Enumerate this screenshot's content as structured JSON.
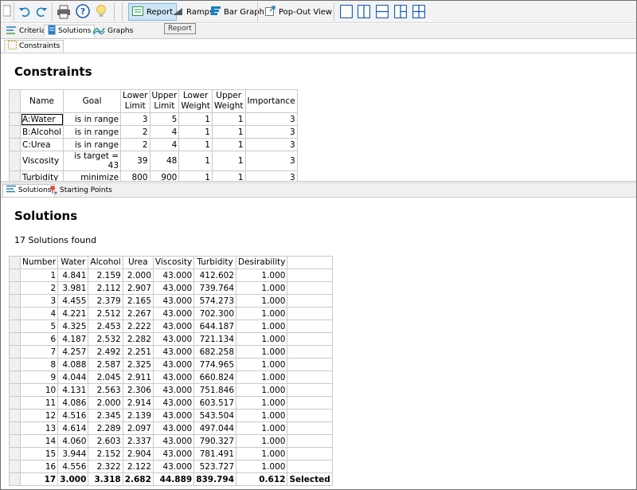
{
  "toolbar": {
    "report_label": "Report",
    "ramps_label": "Ramps",
    "bargraph_label": "Bar Graph",
    "popout_label": "Pop-Out View",
    "tooltip": "Report",
    "colors": {
      "accent": "#1a7fc1",
      "bulb": "#f7c948",
      "print": "#555555"
    }
  },
  "top_tabs": [
    {
      "label": "Criteria",
      "icon": "criteria-icon"
    },
    {
      "label": "Solutions",
      "icon": "solutions-icon"
    },
    {
      "label": "Graphs",
      "icon": "graphs-icon"
    }
  ],
  "sub_tab_constraints": {
    "label": "Constraints"
  },
  "constraints": {
    "title": "Constraints",
    "headers": [
      "Name",
      "Goal",
      "Lower\nLimit",
      "Upper\nLimit",
      "Lower\nWeight",
      "Upper\nWeight",
      "Importance"
    ],
    "rows": [
      [
        "A:Water",
        "is in range",
        "3",
        "5",
        "1",
        "1",
        "3"
      ],
      [
        "B:Alcohol",
        "is in range",
        "2",
        "4",
        "1",
        "1",
        "3"
      ],
      [
        "C:Urea",
        "is in range",
        "2",
        "4",
        "1",
        "1",
        "3"
      ],
      [
        "Viscosity",
        "is target = 43",
        "39",
        "48",
        "1",
        "1",
        "3"
      ],
      [
        "Turbidity",
        "minimize",
        "800",
        "900",
        "1",
        "1",
        "3"
      ]
    ]
  },
  "lower_tabs": [
    {
      "label": "Solutions",
      "icon": "solutions-icon"
    },
    {
      "label": "Starting Points",
      "icon": "pin-icon"
    }
  ],
  "solutions": {
    "title": "Solutions",
    "found_text": "17 Solutions found",
    "headers": [
      "Number",
      "Water",
      "Alcohol",
      "Urea",
      "Viscosity",
      "Turbidity",
      "Desirability",
      ""
    ],
    "rows": [
      [
        "1",
        "4.841",
        "2.159",
        "2.000",
        "43.000",
        "412.602",
        "1.000",
        ""
      ],
      [
        "2",
        "3.981",
        "2.112",
        "2.907",
        "43.000",
        "739.764",
        "1.000",
        ""
      ],
      [
        "3",
        "4.455",
        "2.379",
        "2.165",
        "43.000",
        "574.273",
        "1.000",
        ""
      ],
      [
        "4",
        "4.221",
        "2.512",
        "2.267",
        "43.000",
        "702.300",
        "1.000",
        ""
      ],
      [
        "5",
        "4.325",
        "2.453",
        "2.222",
        "43.000",
        "644.187",
        "1.000",
        ""
      ],
      [
        "6",
        "4.187",
        "2.532",
        "2.282",
        "43.000",
        "721.134",
        "1.000",
        ""
      ],
      [
        "7",
        "4.257",
        "2.492",
        "2.251",
        "43.000",
        "682.258",
        "1.000",
        ""
      ],
      [
        "8",
        "4.088",
        "2.587",
        "2.325",
        "43.000",
        "774.965",
        "1.000",
        ""
      ],
      [
        "9",
        "4.044",
        "2.045",
        "2.911",
        "43.000",
        "660.824",
        "1.000",
        ""
      ],
      [
        "10",
        "4.131",
        "2.563",
        "2.306",
        "43.000",
        "751.846",
        "1.000",
        ""
      ],
      [
        "11",
        "4.086",
        "2.000",
        "2.914",
        "43.000",
        "603.517",
        "1.000",
        ""
      ],
      [
        "12",
        "4.516",
        "2.345",
        "2.139",
        "43.000",
        "543.504",
        "1.000",
        ""
      ],
      [
        "13",
        "4.614",
        "2.289",
        "2.097",
        "43.000",
        "497.044",
        "1.000",
        ""
      ],
      [
        "14",
        "4.060",
        "2.603",
        "2.337",
        "43.000",
        "790.327",
        "1.000",
        ""
      ],
      [
        "15",
        "3.944",
        "2.152",
        "2.904",
        "43.000",
        "781.491",
        "1.000",
        ""
      ],
      [
        "16",
        "4.556",
        "2.322",
        "2.122",
        "43.000",
        "523.727",
        "1.000",
        ""
      ],
      [
        "17",
        "3.000",
        "3.318",
        "2.682",
        "44.889",
        "839.794",
        "0.612",
        "Selected"
      ]
    ]
  }
}
